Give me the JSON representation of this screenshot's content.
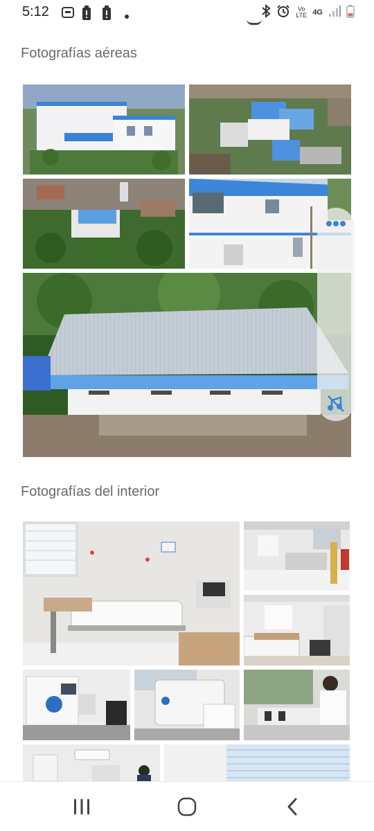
{
  "status_bar": {
    "time": "5:12",
    "network": "4G",
    "volte": "Vo LTE",
    "icons": [
      "messages-icon",
      "battery-alert-icon",
      "battery-alert-icon",
      "dot-icon",
      "bluetooth-icon",
      "alarm-icon",
      "signal-icon",
      "battery-icon"
    ]
  },
  "sections": {
    "aerial_title": "Fotografías aéreas",
    "interior_title": "Fotografías del interior"
  },
  "edge_panel": {
    "icons": [
      "more-dots-icon",
      "mute-icon"
    ]
  },
  "nav": {
    "icons": [
      "recents-icon",
      "home-icon",
      "back-icon"
    ]
  },
  "colors": {
    "accent_blue": "#3b82d6",
    "title_gray": "#6a6a6a"
  }
}
